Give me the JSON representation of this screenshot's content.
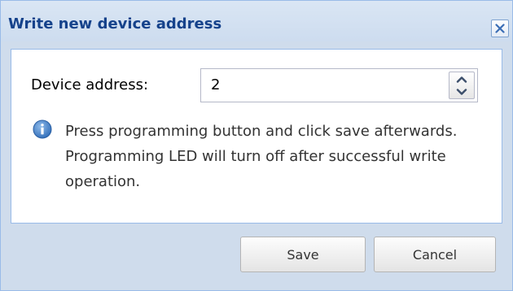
{
  "dialog": {
    "title": "Write new device address",
    "close_icon": "close-icon"
  },
  "form": {
    "address_label": "Device address:",
    "address_value": "2",
    "spinner_icons": [
      "chevron-up-icon",
      "chevron-down-icon"
    ]
  },
  "info": {
    "icon": "info-icon",
    "text": "Press programming button and click save afterwards. Programming LED will turn off after successful write operation."
  },
  "buttons": {
    "save_label": "Save",
    "cancel_label": "Cancel"
  },
  "colors": {
    "title_text": "#15428b",
    "frame": "#cfdcec",
    "border": "#99bbe8",
    "info_icon": "#3a78c4"
  }
}
